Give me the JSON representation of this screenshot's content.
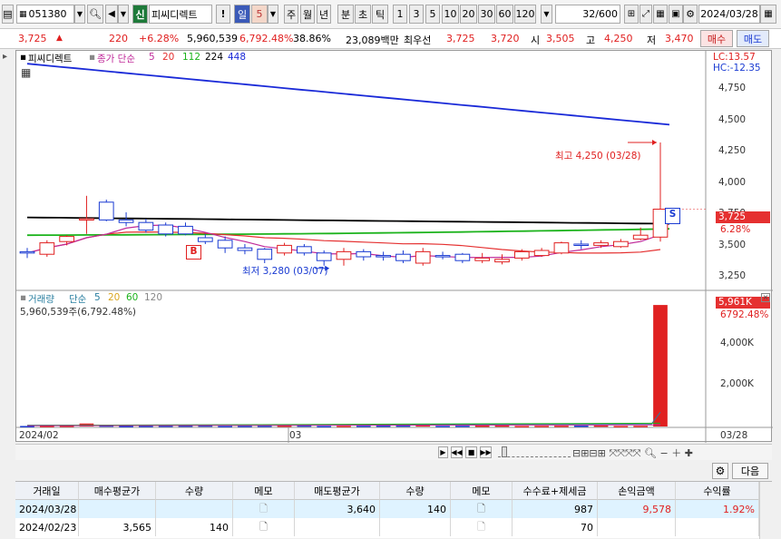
{
  "toolbar": {
    "code": "051380",
    "type_badge": "신",
    "stock_name": "피씨디렉트",
    "alert_icon": "!",
    "period_day": "일",
    "period_num": "5",
    "periods": [
      "주",
      "월",
      "년",
      "분",
      "초",
      "틱"
    ],
    "counts": [
      "1",
      "3",
      "5",
      "10",
      "20",
      "30",
      "60",
      "120"
    ],
    "view_count": "32",
    "view_total": "/600",
    "date": "2024/03/28"
  },
  "quote": {
    "price": "3,725",
    "change": "220",
    "change_pct": "+6.28%",
    "volume": "5,960,539",
    "volume_pct": "6,792.48%",
    "turnover": "38.86%",
    "amount": "23,089백만",
    "best_label": "최우선",
    "best_ask": "3,725",
    "best_bid": "3,720",
    "open_label": "시",
    "open": "3,505",
    "high_label": "고",
    "high": "4,250",
    "low_label": "저",
    "low": "3,470",
    "buy_button": "매수",
    "sell_button": "매도"
  },
  "price_chart": {
    "legend_name": "피씨디렉트",
    "legend_ma": "종가 단순",
    "ma_periods": [
      "5",
      "20",
      "112",
      "224",
      "448"
    ],
    "lc": "LC:13.57",
    "hc": "HC:-12.35",
    "y_ticks": [
      "4,750",
      "4,500",
      "4,250",
      "4,000",
      "3,750",
      "3,500",
      "3,250"
    ],
    "current_price": "3,725",
    "current_pct": "6.28%",
    "high_annotation": "최고 4,250 (03/28)",
    "low_annotation": "최저 3,280 (03/07)",
    "buy_marker": "B",
    "sell_marker": "S"
  },
  "volume_chart": {
    "legend_name": "거래량",
    "legend_ma": "단순",
    "ma_periods": [
      "5",
      "20",
      "60",
      "120"
    ],
    "volume_text": "5,960,539주(6,792.48%)",
    "current_volume": "5,961K",
    "current_pct": "6792.48%",
    "y_ticks": [
      "4,000K",
      "2,000K"
    ]
  },
  "x_axis": {
    "start": "2024/02",
    "mid": "03",
    "end": "03/28"
  },
  "chart_data": {
    "type": "candlestick",
    "ylim": [
      3100,
      4900
    ],
    "candles": [
      {
        "o": 3390,
        "h": 3420,
        "l": 3340,
        "c": 3380
      },
      {
        "o": 3370,
        "h": 3480,
        "l": 3350,
        "c": 3460
      },
      {
        "o": 3470,
        "h": 3520,
        "l": 3440,
        "c": 3510
      },
      {
        "o": 3650,
        "h": 3830,
        "l": 3530,
        "c": 3650
      },
      {
        "o": 3780,
        "h": 3800,
        "l": 3630,
        "c": 3640
      },
      {
        "o": 3640,
        "h": 3700,
        "l": 3590,
        "c": 3620
      },
      {
        "o": 3620,
        "h": 3650,
        "l": 3540,
        "c": 3560
      },
      {
        "o": 3600,
        "h": 3620,
        "l": 3510,
        "c": 3530
      },
      {
        "o": 3590,
        "h": 3620,
        "l": 3520,
        "c": 3530
      },
      {
        "o": 3500,
        "h": 3530,
        "l": 3450,
        "c": 3470
      },
      {
        "o": 3480,
        "h": 3510,
        "l": 3380,
        "c": 3420
      },
      {
        "o": 3420,
        "h": 3450,
        "l": 3370,
        "c": 3400
      },
      {
        "o": 3410,
        "h": 3420,
        "l": 3300,
        "c": 3330
      },
      {
        "o": 3380,
        "h": 3460,
        "l": 3360,
        "c": 3440
      },
      {
        "o": 3430,
        "h": 3450,
        "l": 3360,
        "c": 3380
      },
      {
        "o": 3380,
        "h": 3400,
        "l": 3280,
        "c": 3320
      },
      {
        "o": 3330,
        "h": 3420,
        "l": 3280,
        "c": 3390
      },
      {
        "o": 3390,
        "h": 3410,
        "l": 3320,
        "c": 3350
      },
      {
        "o": 3360,
        "h": 3390,
        "l": 3320,
        "c": 3350
      },
      {
        "o": 3370,
        "h": 3400,
        "l": 3300,
        "c": 3320
      },
      {
        "o": 3300,
        "h": 3420,
        "l": 3280,
        "c": 3390
      },
      {
        "o": 3360,
        "h": 3390,
        "l": 3330,
        "c": 3350
      },
      {
        "o": 3370,
        "h": 3380,
        "l": 3300,
        "c": 3320
      },
      {
        "o": 3320,
        "h": 3380,
        "l": 3300,
        "c": 3340
      },
      {
        "o": 3310,
        "h": 3370,
        "l": 3290,
        "c": 3330
      },
      {
        "o": 3340,
        "h": 3410,
        "l": 3320,
        "c": 3390
      },
      {
        "o": 3360,
        "h": 3420,
        "l": 3350,
        "c": 3400
      },
      {
        "o": 3380,
        "h": 3470,
        "l": 3370,
        "c": 3460
      },
      {
        "o": 3450,
        "h": 3480,
        "l": 3410,
        "c": 3440
      },
      {
        "o": 3440,
        "h": 3480,
        "l": 3420,
        "c": 3460
      },
      {
        "o": 3430,
        "h": 3490,
        "l": 3420,
        "c": 3470
      },
      {
        "o": 3490,
        "h": 3580,
        "l": 3480,
        "c": 3520
      },
      {
        "o": 3505,
        "h": 4250,
        "l": 3470,
        "c": 3725
      }
    ],
    "ma_448": {
      "start": 4870,
      "end": 4390
    },
    "ma_224": {
      "start": 3660,
      "end": 3610
    },
    "ma_112": {
      "start": 3520,
      "end": 3570
    },
    "volume_last": 5961
  },
  "table": {
    "gear_icon": "gear-icon",
    "next_button": "다음",
    "headers": [
      "거래일",
      "매수평균가",
      "수량",
      "메모",
      "매도평균가",
      "수량",
      "메모",
      "수수료+제세금",
      "손익금액",
      "수익률"
    ],
    "rows": [
      {
        "date": "2024/03/28",
        "buy_avg": "",
        "buy_qty": "",
        "sell_avg": "3,640",
        "sell_qty": "140",
        "fee": "987",
        "pnl": "9,578",
        "ret": "1.92%"
      },
      {
        "date": "2024/02/23",
        "buy_avg": "3,565",
        "buy_qty": "140",
        "sell_avg": "",
        "sell_qty": "",
        "fee": "70",
        "pnl": "",
        "ret": ""
      }
    ]
  }
}
